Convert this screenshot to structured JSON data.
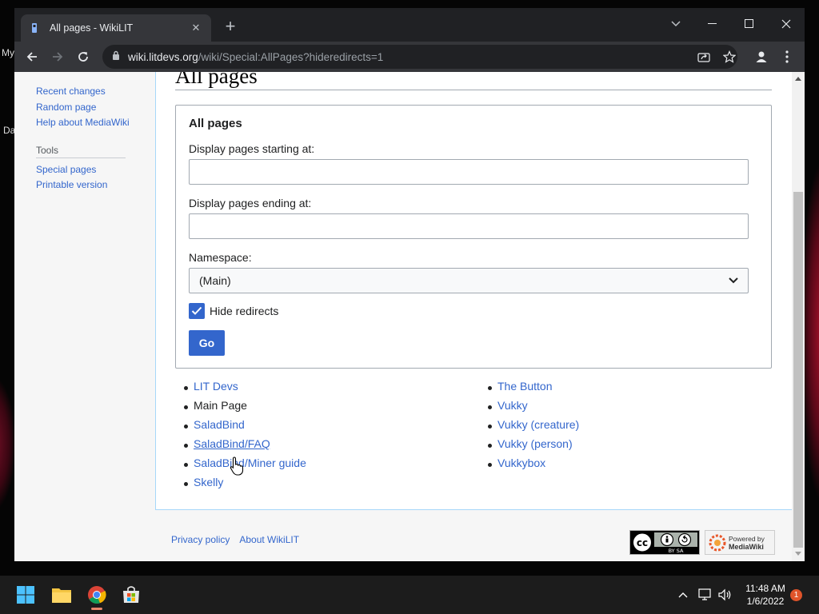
{
  "desktop": {
    "label_1": "My",
    "label_2": "Da"
  },
  "browser": {
    "tab_title": "All pages - WikiLIT",
    "tab_close": "✕",
    "new_tab": "+",
    "url_host": "wiki.litdevs.org",
    "url_path": "/wiki/Special:AllPages?hideredirects=1"
  },
  "sidebar": {
    "items_top": [
      "Recent changes",
      "Random page",
      "Help about MediaWiki"
    ],
    "tools_heading": "Tools",
    "tools_items": [
      "Special pages",
      "Printable version"
    ]
  },
  "content": {
    "heading": "All pages",
    "form": {
      "legend": "All pages",
      "start_label": "Display pages starting at:",
      "start_value": "",
      "end_label": "Display pages ending at:",
      "end_value": "",
      "namespace_label": "Namespace:",
      "namespace_value": "(Main)",
      "hide_redirects_label": "Hide redirects",
      "hide_redirects_checked": true,
      "go_label": "Go"
    },
    "pages_left": [
      "LIT Devs",
      "Main Page",
      "SaladBind",
      "SaladBind/FAQ",
      "SaladBind/Miner guide",
      "Skelly"
    ],
    "pages_right": [
      "The Button",
      "Vukky",
      "Vukky (creature)",
      "Vukky (person)",
      "Vukkybox"
    ]
  },
  "footer": {
    "privacy": "Privacy policy",
    "about": "About WikiLIT",
    "cc_text": "BY SA",
    "mw_line1": "Powered by",
    "mw_line2": "MediaWiki"
  },
  "taskbar": {
    "time": "11:48 AM",
    "date": "1/6/2022",
    "notifications": "1"
  },
  "colors": {
    "link": "#3366cc",
    "chrome_dark": "#202124",
    "chrome_toolbar": "#35363a",
    "taskbar": "#1c1c1c"
  }
}
